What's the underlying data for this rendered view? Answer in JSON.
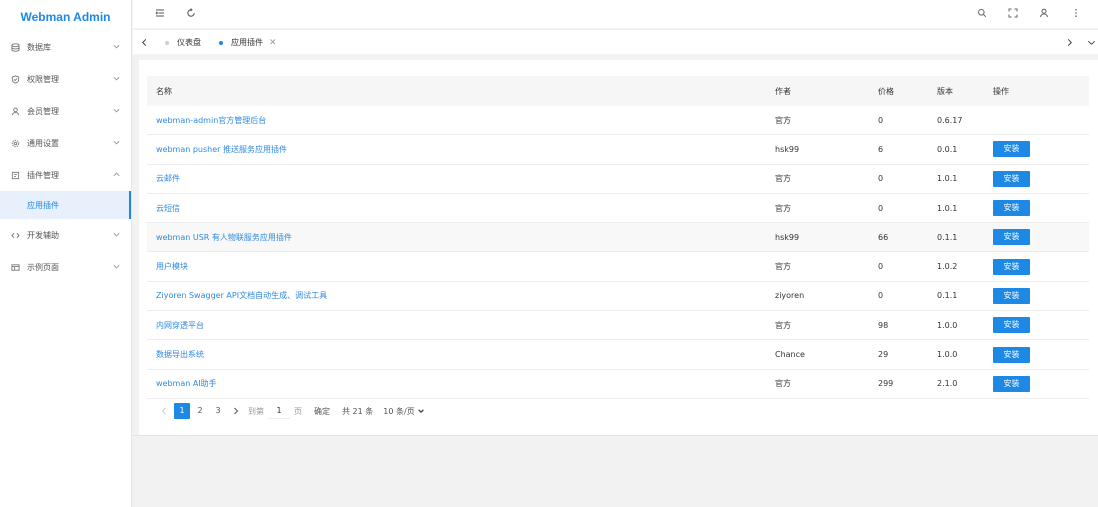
{
  "app": {
    "title": "Webman Admin"
  },
  "sidebar": {
    "items": [
      {
        "label": "数据库",
        "icon": "database-icon"
      },
      {
        "label": "权限管理",
        "icon": "shield-icon"
      },
      {
        "label": "会员管理",
        "icon": "user-icon"
      },
      {
        "label": "通用设置",
        "icon": "gear-icon"
      },
      {
        "label": "插件管理",
        "icon": "plugin-icon",
        "expanded": true,
        "children": [
          {
            "label": "应用插件",
            "active": true
          }
        ]
      },
      {
        "label": "开发辅助",
        "icon": "code-icon"
      },
      {
        "label": "示例页面",
        "icon": "layout-icon"
      }
    ]
  },
  "header": {
    "icons": [
      "menu-fold-icon",
      "refresh-icon",
      "search-icon",
      "fullscreen-icon",
      "user-icon",
      "more-icon"
    ]
  },
  "tabs": {
    "items": [
      {
        "label": "仪表盘",
        "active": false
      },
      {
        "label": "应用插件",
        "active": true,
        "closable": true
      }
    ],
    "close_glyph": "✕"
  },
  "table": {
    "headers": [
      "名称",
      "作者",
      "价格",
      "版本",
      "操作"
    ],
    "install_label": "安装",
    "rows": [
      {
        "name": "webman-admin官方管理后台",
        "author": "官方",
        "price": "0",
        "version": "0.6.17",
        "installable": false
      },
      {
        "name": "webman pusher 推送服务应用插件",
        "author": "hsk99",
        "price": "6",
        "version": "0.0.1",
        "installable": true
      },
      {
        "name": "云邮件",
        "author": "官方",
        "price": "0",
        "version": "1.0.1",
        "installable": true
      },
      {
        "name": "云短信",
        "author": "官方",
        "price": "0",
        "version": "1.0.1",
        "installable": true
      },
      {
        "name": "webman USR 有人物联服务应用插件",
        "author": "hsk99",
        "price": "66",
        "version": "0.1.1",
        "installable": true
      },
      {
        "name": "用户模块",
        "author": "官方",
        "price": "0",
        "version": "1.0.2",
        "installable": true
      },
      {
        "name": "Ziyoren Swagger API文档自动生成、调试工具",
        "author": "ziyoren",
        "price": "0",
        "version": "0.1.1",
        "installable": true
      },
      {
        "name": "内网穿透平台",
        "author": "官方",
        "price": "98",
        "version": "1.0.0",
        "installable": true
      },
      {
        "name": "数据导出系统",
        "author": "Chance",
        "price": "29",
        "version": "1.0.0",
        "installable": true
      },
      {
        "name": "webman AI助手",
        "author": "官方",
        "price": "299",
        "version": "2.1.0",
        "installable": true
      }
    ]
  },
  "pagination": {
    "pages": [
      "1",
      "2",
      "3"
    ],
    "current": "1",
    "goto_label": "到第",
    "goto_value": "1",
    "page_unit": "页",
    "confirm_label": "确定",
    "total_label": "共 21 条",
    "page_size_label": "10 条/页"
  },
  "colors": {
    "accent": "#1e88e5",
    "link": "#2f8ae0"
  }
}
